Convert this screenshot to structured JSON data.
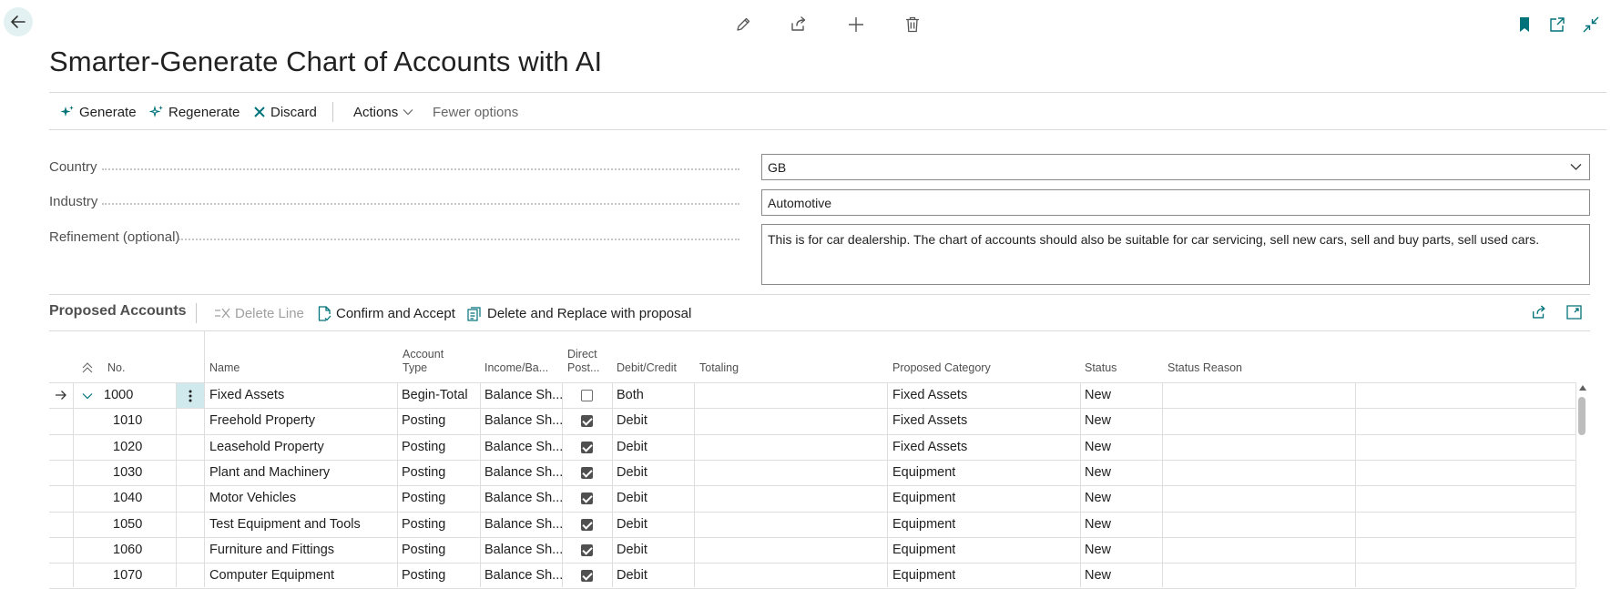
{
  "page": {
    "title": "Smarter-Generate Chart of Accounts with AI"
  },
  "icons": {
    "back": "arrow-left-icon",
    "edit": "pencil-icon",
    "share": "share-icon",
    "new": "plus-icon",
    "delete": "trash-icon",
    "bookmark": "bookmark-icon",
    "open_new_window": "open-in-new-window-icon",
    "collapse": "collapse-icon"
  },
  "actions": {
    "generate": "Generate",
    "regenerate": "Regenerate",
    "discard": "Discard",
    "actions_menu": "Actions",
    "fewer_options": "Fewer options"
  },
  "fields": {
    "country": {
      "label": "Country",
      "value": "GB"
    },
    "industry": {
      "label": "Industry",
      "value": "Automotive"
    },
    "refinement": {
      "label": "Refinement (optional)",
      "value": "This is for car dealership. The chart of accounts should also be suitable for car servicing, sell new cars, sell and buy parts, sell used cars."
    }
  },
  "proposed": {
    "title": "Proposed Accounts",
    "delete_line": "Delete Line",
    "confirm_accept": "Confirm and Accept",
    "delete_replace": "Delete and Replace with proposal"
  },
  "table": {
    "columns": {
      "no": "No.",
      "name": "Name",
      "account_type_1": "Account",
      "account_type_2": "Type",
      "income_balance": "Income/Ba...",
      "direct_post_1": "Direct",
      "direct_post_2": "Post...",
      "debit_credit": "Debit/Credit",
      "totaling": "Totaling",
      "proposed_category": "Proposed Category",
      "status": "Status",
      "status_reason": "Status Reason"
    },
    "rows": [
      {
        "no": "1000",
        "name": "Fixed Assets",
        "account_type": "Begin-Total",
        "income_balance": "Balance Sh...",
        "direct_posting": false,
        "debit_credit": "Both",
        "totaling": "",
        "category": "Fixed Assets",
        "status": "New",
        "status_reason": ""
      },
      {
        "no": "1010",
        "name": "Freehold Property",
        "account_type": "Posting",
        "income_balance": "Balance Sh...",
        "direct_posting": true,
        "debit_credit": "Debit",
        "totaling": "",
        "category": "Fixed Assets",
        "status": "New",
        "status_reason": ""
      },
      {
        "no": "1020",
        "name": "Leasehold Property",
        "account_type": "Posting",
        "income_balance": "Balance Sh...",
        "direct_posting": true,
        "debit_credit": "Debit",
        "totaling": "",
        "category": "Fixed Assets",
        "status": "New",
        "status_reason": ""
      },
      {
        "no": "1030",
        "name": "Plant and Machinery",
        "account_type": "Posting",
        "income_balance": "Balance Sh...",
        "direct_posting": true,
        "debit_credit": "Debit",
        "totaling": "",
        "category": "Equipment",
        "status": "New",
        "status_reason": ""
      },
      {
        "no": "1040",
        "name": "Motor Vehicles",
        "account_type": "Posting",
        "income_balance": "Balance Sh...",
        "direct_posting": true,
        "debit_credit": "Debit",
        "totaling": "",
        "category": "Equipment",
        "status": "New",
        "status_reason": ""
      },
      {
        "no": "1050",
        "name": "Test Equipment and Tools",
        "account_type": "Posting",
        "income_balance": "Balance Sh...",
        "direct_posting": true,
        "debit_credit": "Debit",
        "totaling": "",
        "category": "Equipment",
        "status": "New",
        "status_reason": ""
      },
      {
        "no": "1060",
        "name": "Furniture and Fittings",
        "account_type": "Posting",
        "income_balance": "Balance Sh...",
        "direct_posting": true,
        "debit_credit": "Debit",
        "totaling": "",
        "category": "Equipment",
        "status": "New",
        "status_reason": ""
      },
      {
        "no": "1070",
        "name": "Computer Equipment",
        "account_type": "Posting",
        "income_balance": "Balance Sh...",
        "direct_posting": true,
        "debit_credit": "Debit",
        "totaling": "",
        "category": "Equipment",
        "status": "New",
        "status_reason": ""
      }
    ]
  },
  "colors": {
    "accent": "#00727a",
    "text": "#212121",
    "muted": "#505050",
    "selected_cell": "#cfe9ec"
  }
}
